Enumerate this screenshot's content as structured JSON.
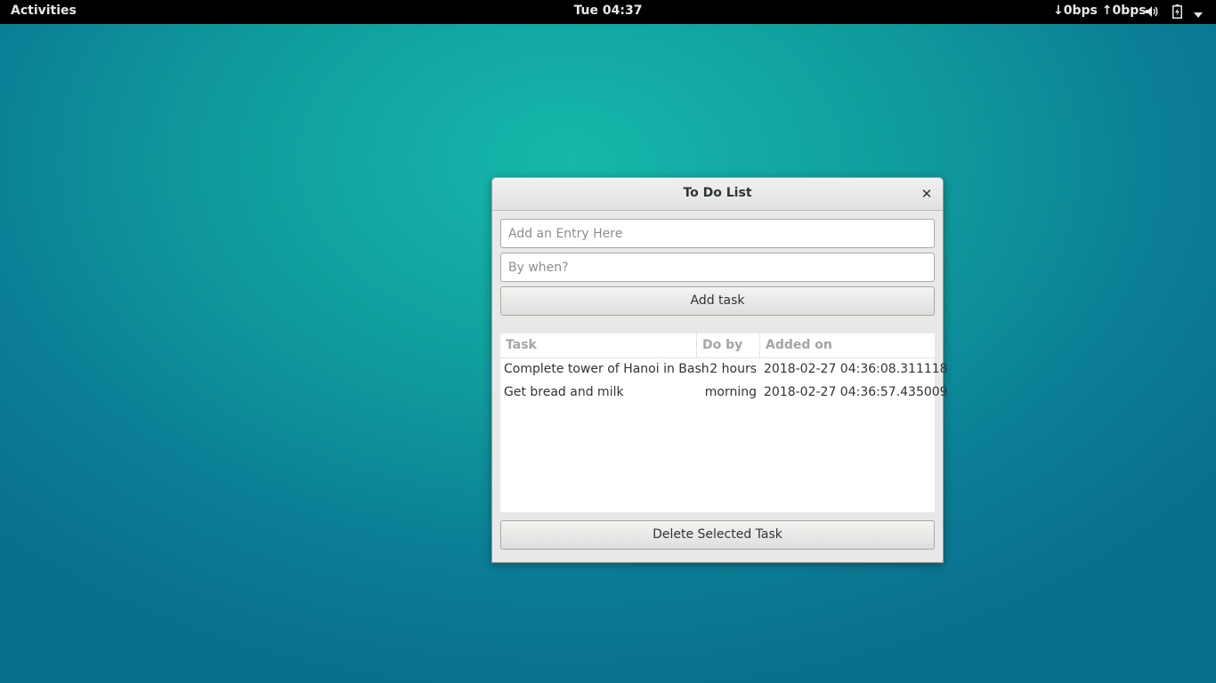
{
  "topbar": {
    "activities": "Activities",
    "clock": "Tue 04:37",
    "network": "↓0bps ↑0bps",
    "icons": [
      "volume-icon",
      "battery-icon",
      "system-menu-arrow-icon"
    ]
  },
  "window": {
    "title": "To Do List",
    "entry_placeholder": "Add an Entry Here",
    "entry_value": "",
    "when_placeholder": "By when?",
    "when_value": "",
    "add_button": "Add task",
    "delete_button": "Delete Selected Task"
  },
  "tasks": {
    "columns": [
      "Task",
      "Do by",
      "Added on"
    ],
    "rows": [
      {
        "task": "Complete tower of Hanoi in Bash",
        "doby": "2 hours",
        "added": "2018-02-27 04:36:08.311118"
      },
      {
        "task": "Get bread and milk",
        "doby": "morning",
        "added": "2018-02-27 04:36:57.435009"
      }
    ]
  },
  "colors": {
    "desktop_accent": "#16b8ab",
    "topbar": "#000000"
  }
}
